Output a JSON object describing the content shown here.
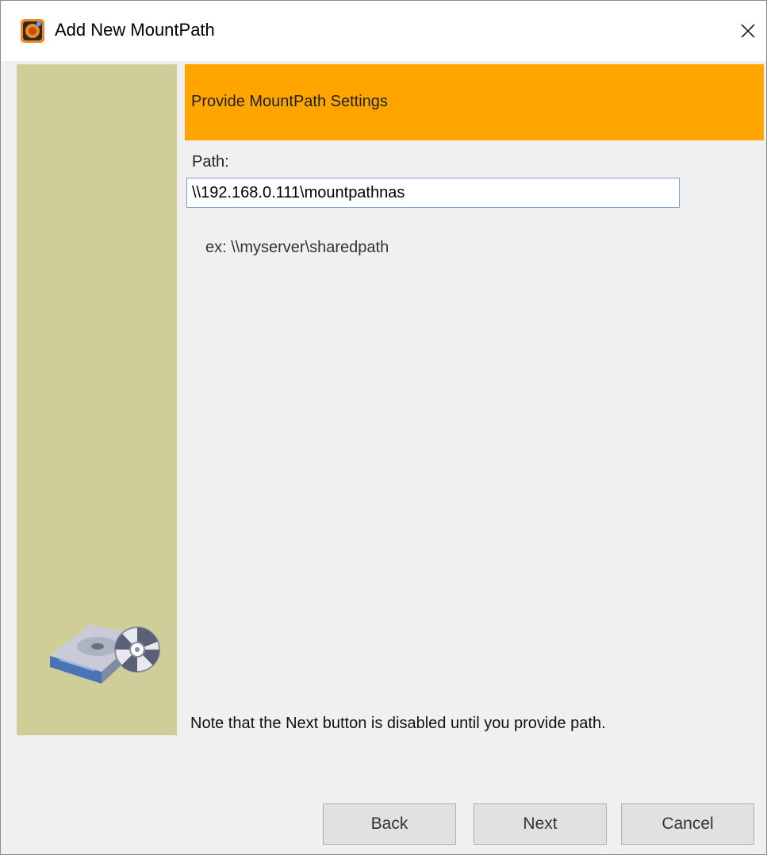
{
  "window": {
    "title": "Add New MountPath",
    "close_icon": "close-icon"
  },
  "header": {
    "title": "Provide MountPath Settings",
    "color": "#ffa500"
  },
  "sidebar": {
    "color": "#cfcd98",
    "illustration": "hard-drive-disk-icon"
  },
  "form": {
    "path_label": "Path:",
    "path_value": "\\\\192.168.0.111\\mountpathnas",
    "example": "ex: \\\\myserver\\sharedpath"
  },
  "note": "Note that the Next button is disabled until you provide path.",
  "buttons": {
    "back": "Back",
    "next": "Next",
    "cancel": "Cancel"
  }
}
